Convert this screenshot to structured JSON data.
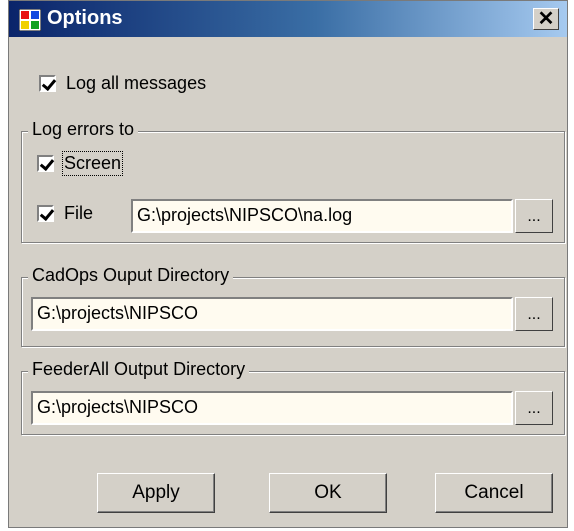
{
  "window": {
    "title": "Options",
    "close_label": "✕"
  },
  "log_all": {
    "label": "Log all messages",
    "checked": true
  },
  "log_errors_group": {
    "legend": "Log errors to",
    "screen": {
      "label": "Screen",
      "checked": true
    },
    "file": {
      "label": "File",
      "checked": true,
      "path": "G:\\projects\\NIPSCO\\na.log",
      "browse": "..."
    }
  },
  "cadops_group": {
    "legend": "CadOps Ouput Directory",
    "path": "G:\\projects\\NIPSCO",
    "browse": "..."
  },
  "feederall_group": {
    "legend": "FeederAll Output Directory",
    "path": "G:\\projects\\NIPSCO",
    "browse": "..."
  },
  "buttons": {
    "apply": "Apply",
    "ok": "OK",
    "cancel": "Cancel"
  }
}
